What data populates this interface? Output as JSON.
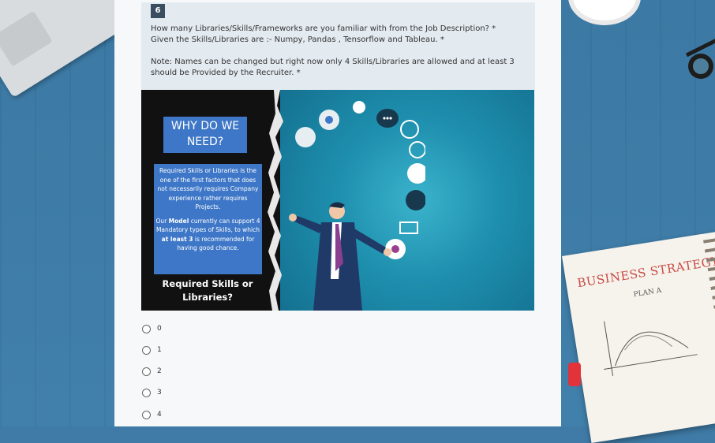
{
  "question": {
    "number": "6",
    "line1": "How many Libraries/Skills/Frameworks are you familiar with from the Job Description? *",
    "line2": "Given the Skills/Libraries are :- Numpy, Pandas , Tensorflow and Tableau. *",
    "note1": "Note: Names can be changed but right now only 4 Skills/Libraries are allowed and at least 3",
    "note2": "should be Provided by the Recruiter. *"
  },
  "banner": {
    "why_line1": "WHY DO WE",
    "why_line2": "NEED?",
    "desc_p1": "Required Skills or Libraries is the one of the first factors that does not necessarily requires Company experience rather requires Projects.",
    "desc_p2_a": "Our ",
    "desc_p2_b": "Model",
    "desc_p2_c": " currently can support 4 Mandatory types of Skills, to which ",
    "desc_p2_d": "at least 3",
    "desc_p2_e": " is recommended for having good chance.",
    "req_line1": "Required Skills or",
    "req_line2": "Libraries?"
  },
  "options": [
    "0",
    "1",
    "2",
    "3",
    "4"
  ],
  "decor": {
    "notebook_title": "BUSINESS STRATEGY",
    "notebook_plan": "PLAN A"
  },
  "colors": {
    "accent": "#3e77c7",
    "qnum_bg": "#3b4e5f",
    "header_bg": "#e3eaf0"
  }
}
